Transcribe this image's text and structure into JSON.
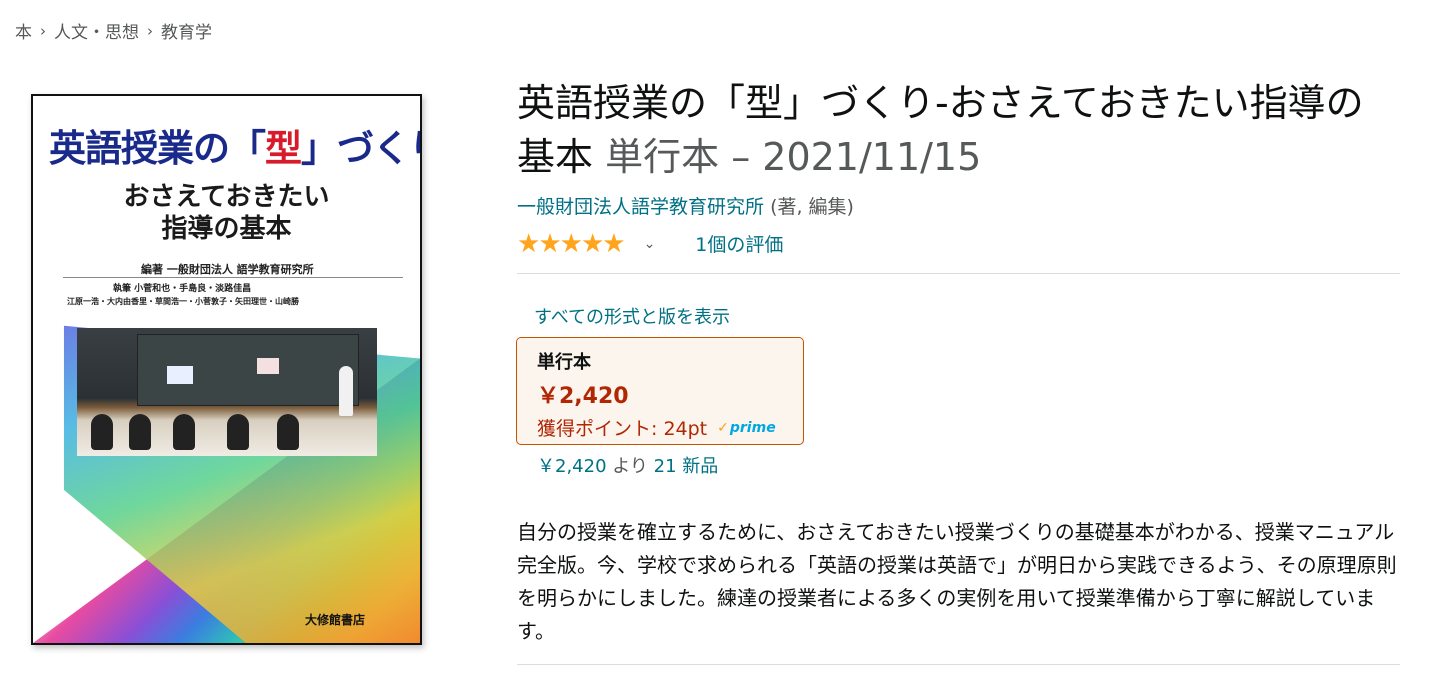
{
  "breadcrumb": {
    "items": [
      "本",
      "人文・思想",
      "教育学"
    ],
    "separator": "›"
  },
  "cover": {
    "title_line1_pre": "英語授業の「",
    "title_line1_red": "型",
    "title_line1_post": "」づくり",
    "title_line2": "おさえておきたい",
    "title_line3": "指導の基本",
    "editor": "編著 一般財団法人 語学教育研究所",
    "authors_line1": "執筆 小菅和也・手島良・淡路佳昌",
    "authors_line2": "江原一浩・大内由香里・草間浩一・小菅敦子・矢田理世・山崎勝",
    "publisher": "大修館書店"
  },
  "product": {
    "title": "英語授業の「型」づくり-おさえておきたい指導の基本",
    "binding_date": "単行本 – 2021/11/15",
    "author": "一般財団法人語学教育研究所",
    "author_role": "(著, 編集)",
    "rating": 5,
    "rating_count": "1個の評価",
    "accent_color": "#ffa41c",
    "link_color": "#007185"
  },
  "formats": {
    "show_all_label": "すべての形式と版を表示",
    "selected": {
      "name": "単行本",
      "price": "￥2,420",
      "points": "獲得ポイント: 24pt",
      "prime_label": "prime"
    },
    "new_offers_price": "￥2,420",
    "new_offers_from": "より",
    "new_offers_count": "21 新品"
  },
  "description": "自分の授業を確立するために、おさえておきたい授業づくりの基礎基本がわかる、授業マニュアル完全版。今、学校で求められる「英語の授業は英語で」が明日から実践できるよう、その原理原則を明らかにしました。練達の授業者による多くの実例を用いて授業準備から丁寧に解説しています。"
}
